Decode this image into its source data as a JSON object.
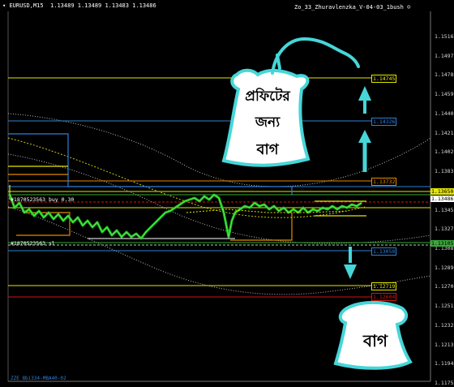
{
  "header": {
    "symbol_timeframe": "EURUSD,M15",
    "ohlc": "1.13489 1.13489 1.13483 1.13486",
    "indicator_name": "Zo_33_Zhuravlenzka_V-04-03_1bush"
  },
  "price_axis": {
    "ticks": [
      "1.15165",
      "1.14975",
      "1.14785",
      "1.14595",
      "1.14405",
      "1.14215",
      "1.14025",
      "1.13835",
      "1.13645",
      "1.13455",
      "1.13270",
      "1.13080",
      "1.12890",
      "1.12700",
      "1.12510",
      "1.12320",
      "1.12130",
      "1.11940",
      "1.11755"
    ],
    "current_price": "1.13486"
  },
  "level_tags": {
    "top_target": "1.14745",
    "second_target": "1.14326",
    "third_target": "1.13732",
    "upper_level": "1.13650",
    "upper_level_2": "1.13610",
    "lower_level": "1.13105",
    "stop_level": "1.13050",
    "bottom_target": "1.12719",
    "lowest": "1.12604"
  },
  "chart_annotations": {
    "buy_order": "#1870523563 buy 0.30",
    "sl_order": "#1870523563 sl",
    "footer_label": "ZZE 8bi334-MBA40-02"
  },
  "bengali_text": {
    "profit_line1": "প্রফিটের",
    "profit_line2": "জন্য",
    "profit_line3": "বাগ",
    "bottom_bag": "বাগ"
  },
  "colors": {
    "accent_cyan": "#46d6d8",
    "level_yellow": "#e4e600",
    "level_red": "#d11515",
    "level_green": "#3aa63a",
    "level_blue": "#2e7fd6",
    "candles_green": "#11cc11"
  }
}
